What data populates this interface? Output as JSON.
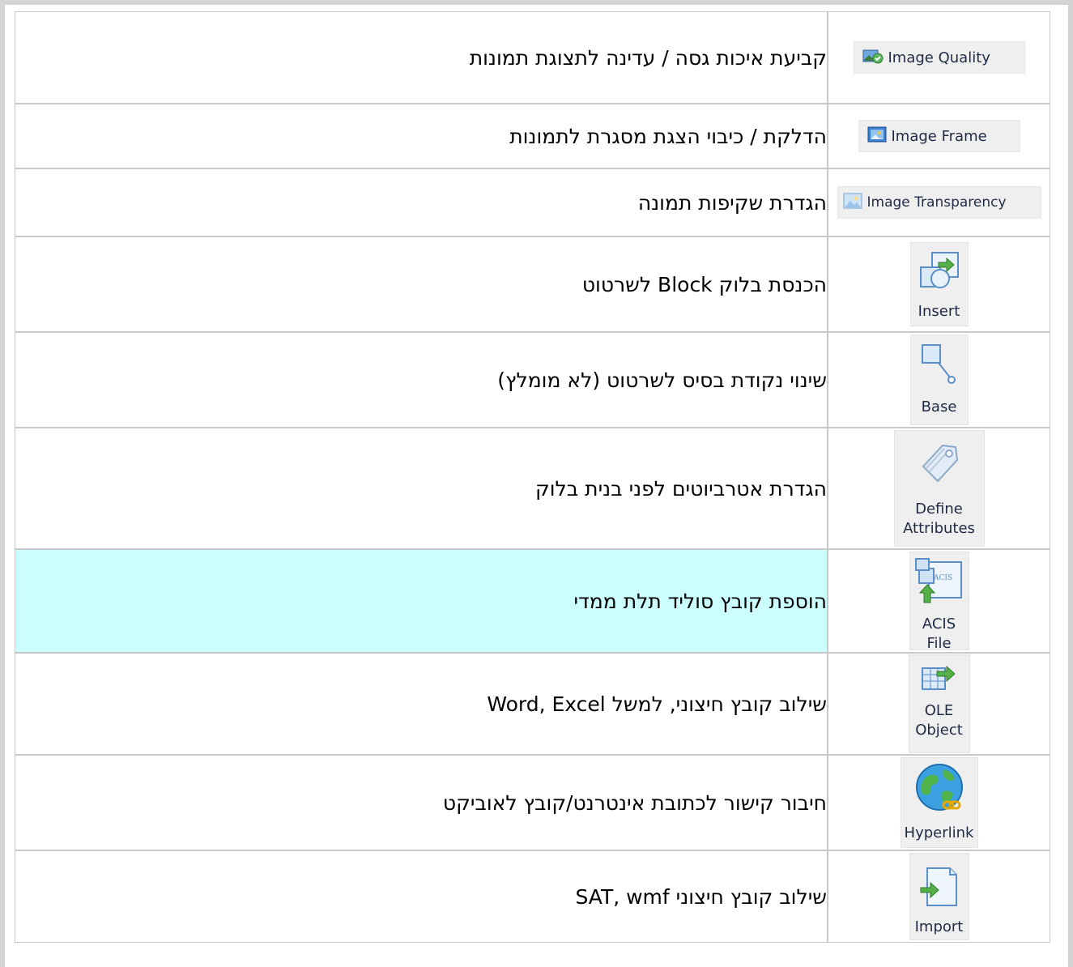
{
  "rows": [
    {
      "desc": "קביעת איכות גסה / עדינה לתצוגת תמונות",
      "icon": "image-quality-icon",
      "label": "Image Quality",
      "label2": ""
    },
    {
      "desc": "הדלקת / כיבוי הצגת מסגרת לתמונות",
      "icon": "image-frame-icon",
      "label": "Image Frame",
      "label2": ""
    },
    {
      "desc": "הגדרת שקיפות תמונה",
      "icon": "image-transparency-icon",
      "label": "Image Transparency",
      "label2": ""
    },
    {
      "desc": "הכנסת בלוק Block לשרטוט",
      "icon": "insert-block-icon",
      "label": "Insert",
      "label2": ""
    },
    {
      "desc": "שינוי נקודת בסיס לשרטוט (לא מומלץ)",
      "icon": "base-point-icon",
      "label": "Base",
      "label2": ""
    },
    {
      "desc": "הגדרת אטרביוטים לפני בנית בלוק",
      "icon": "define-attributes-icon",
      "label": "Define",
      "label2": "Attributes"
    },
    {
      "desc": "הוספת קובץ סוליד תלת ממדי",
      "icon": "acis-file-icon",
      "label": "ACIS",
      "label2": "File"
    },
    {
      "desc": "שילוב קובץ חיצוני, למשל Word, Excel",
      "icon": "ole-object-icon",
      "label": "OLE",
      "label2": "Object"
    },
    {
      "desc": "חיבור קישור לכתובת אינטרנט/קובץ לאוביקט",
      "icon": "hyperlink-icon",
      "label": "Hyperlink",
      "label2": ""
    },
    {
      "desc": "שילוב קובץ חיצוני SAT, wmf",
      "icon": "import-icon",
      "label": "Import",
      "label2": ""
    }
  ],
  "colors": {
    "highlight_row": "#ccfeff",
    "border": "#c8c8c8"
  }
}
